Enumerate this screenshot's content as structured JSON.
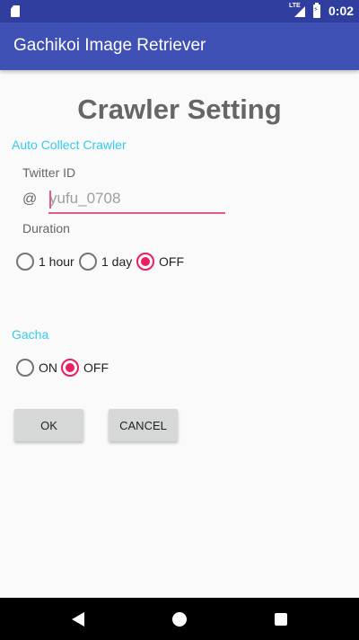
{
  "status_bar": {
    "network": "LTE",
    "time": "0:02"
  },
  "app_bar": {
    "title": "Gachikoi Image Retriever"
  },
  "page": {
    "title": "Crawler Setting"
  },
  "auto_collect": {
    "section_label": "Auto Collect Crawler",
    "twitter_id_label": "Twitter ID",
    "at_prefix": "@",
    "twitter_id_placeholder": "yufu_0708",
    "duration_label": "Duration",
    "duration_options": [
      {
        "label": "1 hour",
        "checked": false
      },
      {
        "label": "1 day",
        "checked": false
      },
      {
        "label": "OFF",
        "checked": true
      }
    ]
  },
  "gacha": {
    "section_label": "Gacha",
    "options": [
      {
        "label": "ON",
        "checked": false
      },
      {
        "label": "OFF",
        "checked": true
      }
    ]
  },
  "buttons": {
    "ok": "OK",
    "cancel": "CANCEL"
  },
  "colors": {
    "status_bar": "#303f9f",
    "app_bar": "#3f51b5",
    "accent": "#e91e63",
    "section_label": "#33ccee"
  }
}
